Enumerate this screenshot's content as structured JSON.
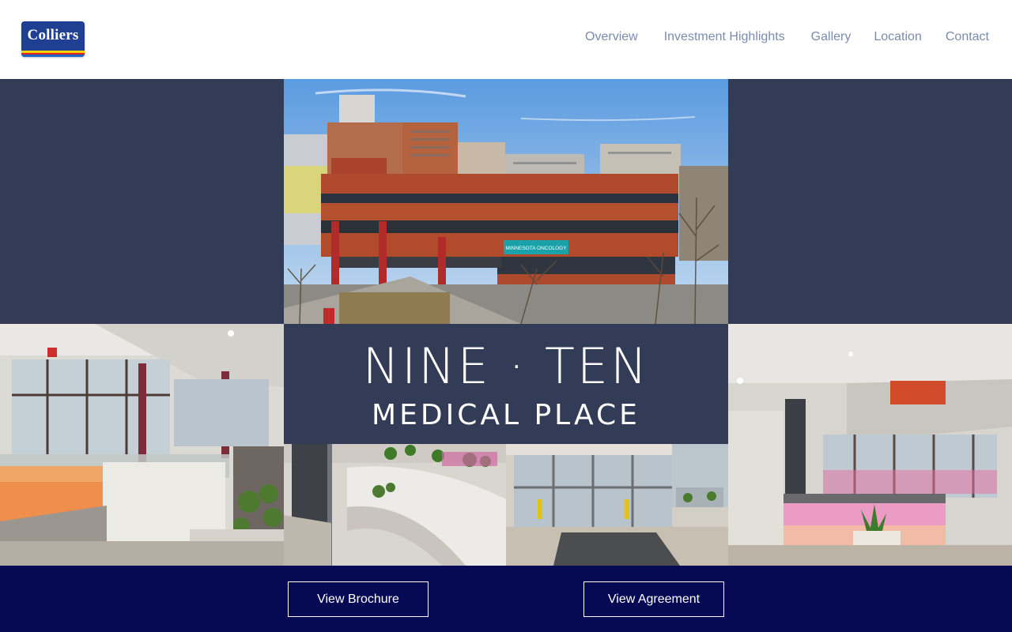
{
  "brand": {
    "logo_text": "Colliers",
    "colors": {
      "logo_blue": "#1f3f93",
      "stripe_yellow": "#f4d10b",
      "stripe_red": "#e2231a",
      "stripe_blue": "#1c64c8"
    }
  },
  "nav": {
    "items": [
      {
        "label": "Overview"
      },
      {
        "label": "Investment Highlights"
      },
      {
        "label": "Gallery"
      },
      {
        "label": "Location"
      },
      {
        "label": "Contact"
      }
    ],
    "color": "#7a8cae"
  },
  "hero": {
    "title_line1": "NINE · TEN",
    "title_line2": "MEDICAL PLACE",
    "building_sign": "MINNESOTA ONCOLOGY",
    "panel_color": "#333c56"
  },
  "footer": {
    "brochure_label": "View Brochure",
    "agreement_label": "View Agreement",
    "bg_color": "#060a55"
  }
}
